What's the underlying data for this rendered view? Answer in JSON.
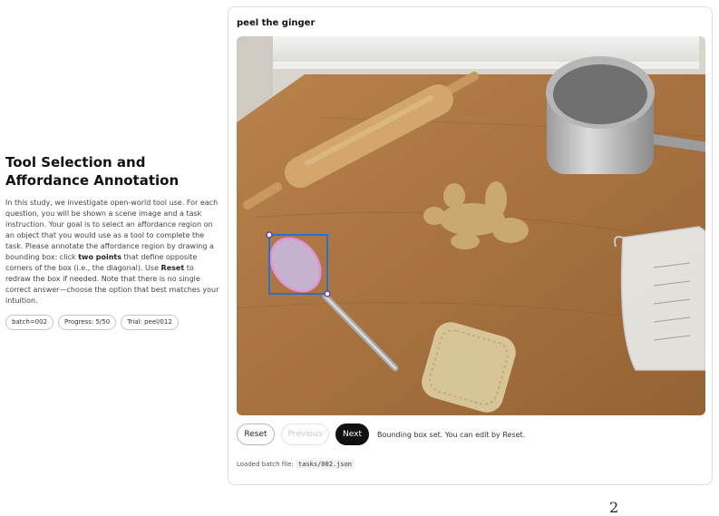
{
  "study": {
    "title": "Tool Selection and Affordance Annotation",
    "description_parts": [
      "In this study, we investigate open-world tool use. For each question, you will be shown a scene image and a task instruction. Your goal is to select an affordance region on an object that you would use as a tool to complete the task. Please annotate the affordance region by drawing a bounding box: click ",
      "two points",
      " that define opposite corners of the box (i.e., the diagonal). Use ",
      "Reset",
      " to redraw the box if needed. Note that there is no single correct answer—choose the option that best matches your intuition."
    ],
    "badges": {
      "batch": "batch=002",
      "progress": "Progress: 5/50",
      "trial": "Trial: peel/012"
    }
  },
  "task": {
    "instruction": "peel the ginger"
  },
  "scene": {
    "objects": [
      "rolling-pin",
      "saucepan",
      "ginger-root",
      "spoon",
      "measuring-cup",
      "loofah-sponge"
    ],
    "selected_object": "spoon",
    "box_color": "#2f6fc9",
    "highlight_color": "#e58fd9"
  },
  "controls": {
    "reset_label": "Reset",
    "previous_label": "Previous",
    "next_label": "Next",
    "status_text": "Bounding box set. You can edit by Reset."
  },
  "footer": {
    "batch_file_label": "Loaded batch file:",
    "batch_file_path": "tasks/002.json",
    "page_number": "2"
  }
}
